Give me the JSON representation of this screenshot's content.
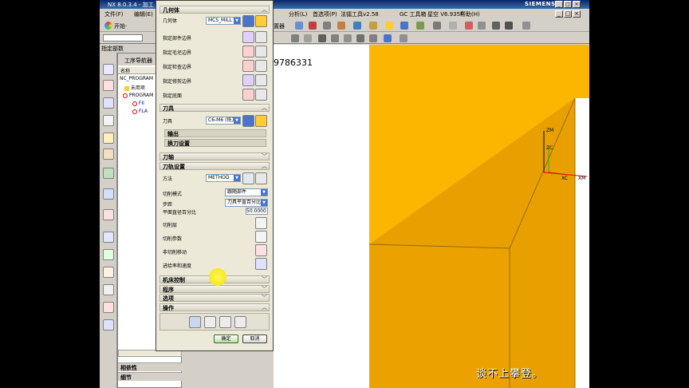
{
  "window": {
    "title": "NX 8.0.3.4 - 加工 - [",
    "brand": "SIEMENS",
    "controls": [
      "_",
      "□",
      "×"
    ]
  },
  "menubar": {
    "left_items": [
      "文件(F)",
      "编辑(E)"
    ],
    "right_items": [
      "分析(L)",
      "首选项(P)",
      "法镭工具v2.58",
      "GC 工具箱",
      "星空 V6.935F",
      "帮助(H)"
    ]
  },
  "toolbar": {
    "start_label": "开始·",
    "device_label": "置器"
  },
  "left_panel": {
    "strip_title": "指定部数",
    "navigator_title": "工序导航器",
    "column_name": "名称",
    "rows": [
      "NC_PROGRAM",
      "未用项",
      "PROGRAM",
      "FII",
      "FLA"
    ],
    "bottom_sections": [
      "相依性",
      "细节"
    ]
  },
  "viewport": {
    "coord_text": "9786331",
    "axis_labels": [
      "ZM",
      "ZC",
      "XC",
      "XM"
    ],
    "subtitle": "谈不上攀登。"
  },
  "dialog": {
    "geometry_section": "几何体",
    "geometry_label": "几何体",
    "geometry_value": "MCS_MILL",
    "geometry_rows": [
      "指定部件边界",
      "指定毛坯边界",
      "指定检查边界",
      "指定修剪边界",
      "指定底面"
    ],
    "tool_section": "刀具",
    "tool_label": "刀具",
    "tool_value": "C6-M6 (铣刀",
    "output_sub": "输出",
    "toolchange_sub": "换刀设置",
    "axis_section": "刀轴",
    "path_section": "刀轨设置",
    "method_label": "方法",
    "method_value": "METHOD",
    "cutmode_label": "切削模式",
    "cutmode_value": "跟随部件",
    "stepover_label": "步距",
    "stepover_value": "刀具平直百分比",
    "percent_label": "平面直径百分比",
    "percent_value": "50.0000",
    "layers_label": "切削层",
    "params_label": "切削参数",
    "noncut_label": "非切削移动",
    "feeds_label": "进给率和速度",
    "machine_section": "机床控制",
    "program_section": "程序",
    "options_section": "选项",
    "ops_section": "操作",
    "ok_label": "确定",
    "cancel_label": "取消"
  }
}
